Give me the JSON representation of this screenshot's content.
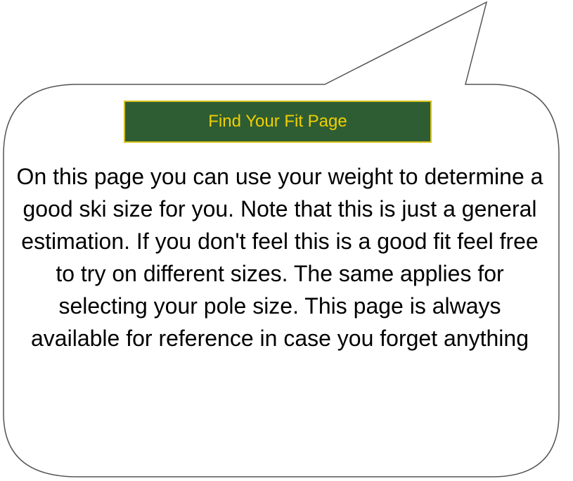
{
  "header": {
    "button_label": "Find Your Fit Page"
  },
  "message": {
    "text": "On this page you can use your weight to determine a good ski size for you. Note that this is just a general estimation. If you don't feel this is a good fit feel free to try on different sizes. The same applies for selecting your pole size. This page is always available for reference in case you forget anything"
  },
  "colors": {
    "button_background": "#2e5d34",
    "button_border": "#d6c21a",
    "button_text": "#f0d000",
    "bubble_stroke": "#555555",
    "text": "#000000"
  }
}
